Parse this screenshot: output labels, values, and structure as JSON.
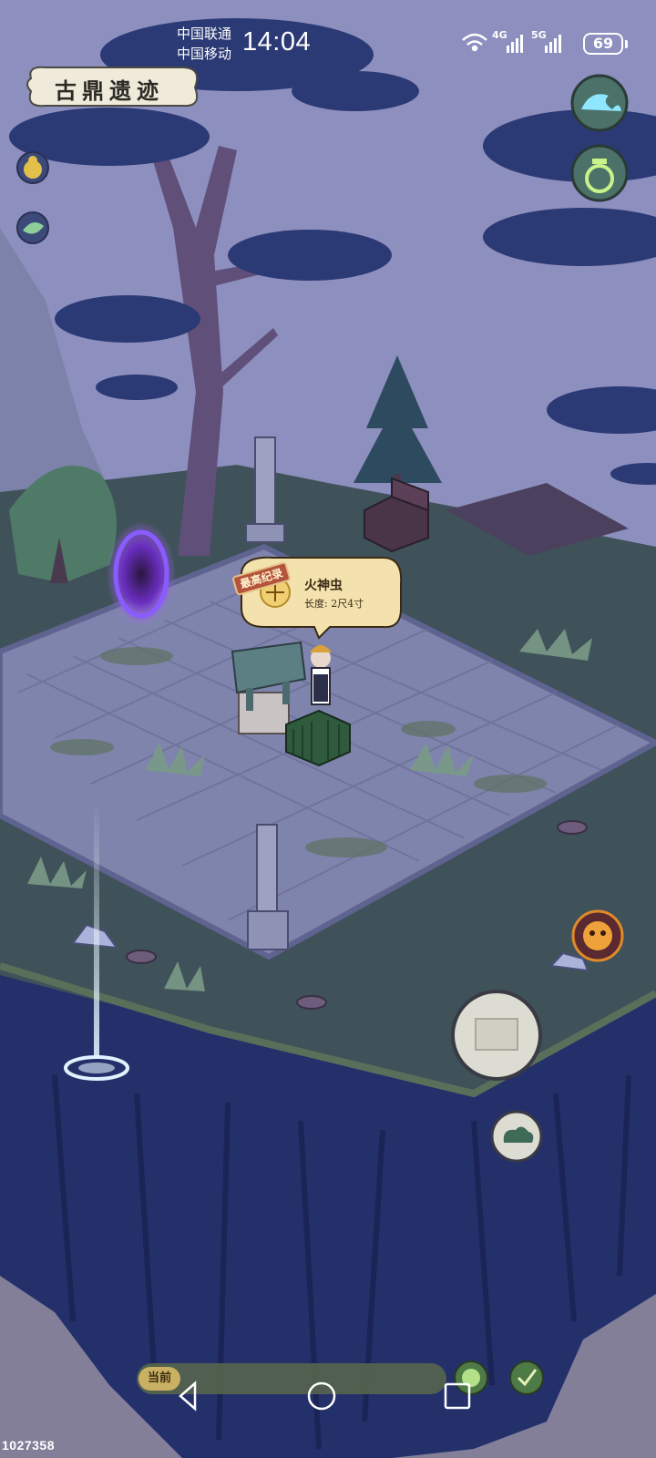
{
  "status_bar": {
    "carrier_1": "中国联通",
    "carrier_2": "中国移动",
    "time": "14:04",
    "network_1": "4G",
    "network_2": "5G",
    "battery": "69"
  },
  "location": {
    "title": "古鼎遗迹"
  },
  "catch_bubble": {
    "tag": "最高纪录",
    "name": "火神虫",
    "length": "长度: 2尺4寸"
  },
  "bottom_bar": {
    "current_label": "当前"
  },
  "watermark": "1027358",
  "colors": {
    "sky": "#8d8fbe",
    "foliage": "#2b3a75",
    "stone": "#7f84ad",
    "grass": "#3f5159",
    "cliff": "#24306a",
    "parchment": "#f4e2ae"
  },
  "icons": {
    "left_top": "gourd-icon",
    "left_second": "leaf-icon",
    "right_top": "wave-icon",
    "right_second": "pot-icon",
    "right_mid": "lion-face-icon",
    "action": "ding-icon",
    "cloud": "cloud-icon",
    "bottom_left": "smiley-icon",
    "bottom_right": "ink-brush-icon"
  }
}
